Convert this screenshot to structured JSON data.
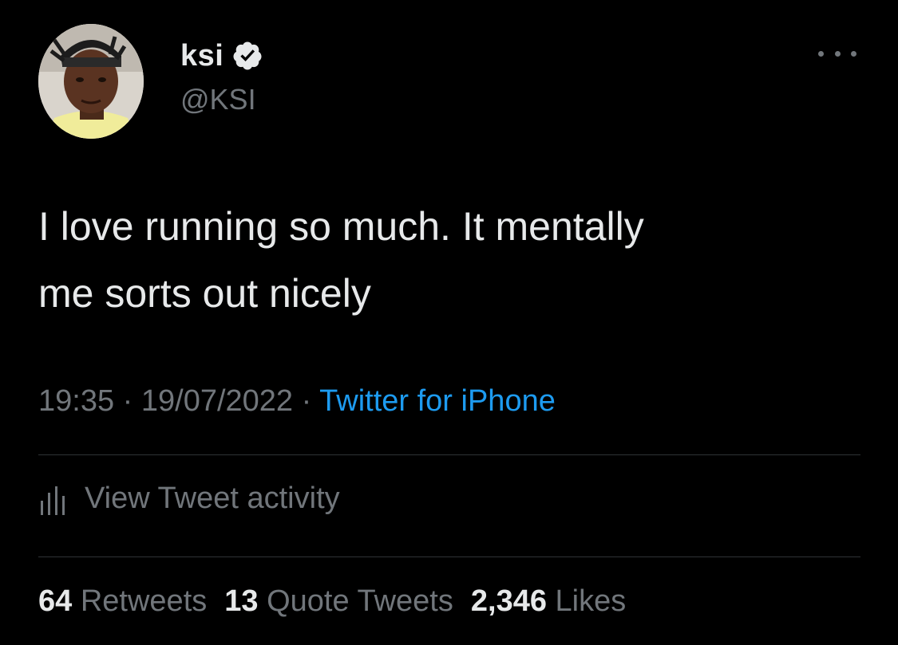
{
  "author": {
    "display_name": "ksi",
    "handle": "@KSI",
    "verified": true
  },
  "tweet": {
    "text": "I love running so much. It mentally\nme sorts out nicely",
    "time": "19:35",
    "separator": "·",
    "date": "19/07/2022",
    "source": "Twitter for iPhone"
  },
  "activity": {
    "label": "View Tweet activity"
  },
  "stats": {
    "retweets_count": "64",
    "retweets_label": "Retweets",
    "quotes_count": "13",
    "quotes_label": "Quote Tweets",
    "likes_count": "2,346",
    "likes_label": "Likes"
  },
  "colors": {
    "background": "#000000",
    "text": "#e7e9ea",
    "muted": "#71767b",
    "link": "#1d9bf0",
    "divider": "#2f3336"
  },
  "icons": [
    "avatar",
    "verified-badge-icon",
    "more-options-icon",
    "analytics-bars-icon"
  ]
}
